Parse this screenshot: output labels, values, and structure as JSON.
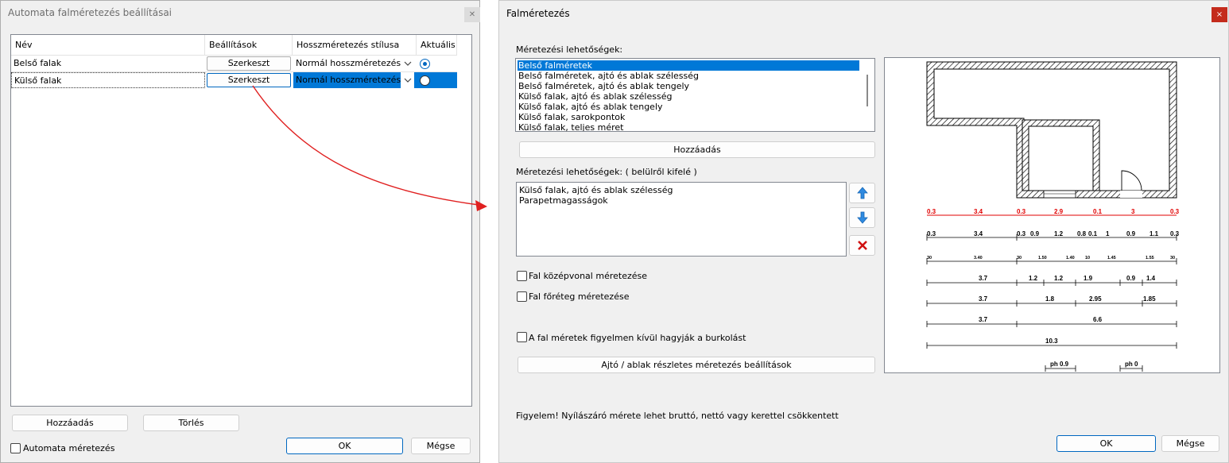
{
  "left_dialog": {
    "title": "Automata falméretezés beállításai",
    "columns": [
      "Név",
      "Beállítások",
      "Hosszméretezés stílusa",
      "Aktuális"
    ],
    "rows": [
      {
        "name": "Belső falak",
        "settings_button": "Szerkeszt",
        "style": "Normál hosszméretezés",
        "current": true
      },
      {
        "name": "Külső falak",
        "settings_button": "Szerkeszt",
        "style": "Normál hosszméretezés",
        "current": false
      }
    ],
    "add_button": "Hozzáadás",
    "delete_button": "Törlés",
    "auto_checkbox_label": "Automata méretezés",
    "ok_button": "OK",
    "cancel_button": "Mégse"
  },
  "right_dialog": {
    "title": "Falméretezés",
    "options_label": "Méretezési lehetőségek:",
    "options": [
      "Belső falméretek",
      "Belső falméretek, ajtó és ablak szélesség",
      "Belső falméretek, ajtó és ablak tengely",
      "Külső falak, ajtó és ablak szélesség",
      "Külső falak, ajtó és ablak tengely",
      "Külső falak, sarokpontok",
      "Külső falak, teljes méret"
    ],
    "selected_option": 0,
    "add_button": "Hozzáadás",
    "ordered_label": "Méretezési lehetőségek: ( belülről kifelé )",
    "ordered_options": [
      "Külső falak, ajtó és ablak szélesség",
      "Parapetmagasságok"
    ],
    "checkbox_centerline": "Fal középvonal méretezése",
    "checkbox_mainlayer": "Fal főréteg méretezése",
    "checkbox_ignore_cladding": "A fal méretek figyelmen kívül hagyják a burkolást",
    "detail_button": "Ajtó / ablak részletes méretezés beállítások",
    "warning": "Figyelem! Nyílászáró mérete lehet bruttó, nettó vagy kerettel csökkentett",
    "ok_button": "OK",
    "cancel_button": "Mégse",
    "close_icon": "×",
    "preview": {
      "red_row": [
        "0.3",
        "3.4",
        "0.3",
        "2.9",
        "0.1",
        "3",
        "0.3"
      ],
      "row2": [
        "0.3",
        "3.4",
        "0.3",
        "0.9",
        "1.2",
        "0.8",
        "0.1",
        "1",
        "0.9",
        "1.1",
        "0.3"
      ],
      "row3": [
        "30",
        "3.40",
        "30",
        "1.50",
        "1.40",
        "10",
        "1.45",
        "1.55",
        "30"
      ],
      "row4": [
        "3.7",
        "1.2",
        "1.2",
        "1.9",
        "0.9",
        "1.4"
      ],
      "row5": [
        "3.7",
        "1.8",
        "2.95",
        "1.85"
      ],
      "row6": [
        "3.7",
        "6.6"
      ],
      "row7": [
        "10.3"
      ],
      "row8": [
        "ph 0.9",
        "ph 0"
      ],
      "accent_red": "#e00000"
    }
  },
  "colors": {
    "selection": "#0078d7",
    "accent": "#0067c0",
    "arrow": "#e02020"
  }
}
